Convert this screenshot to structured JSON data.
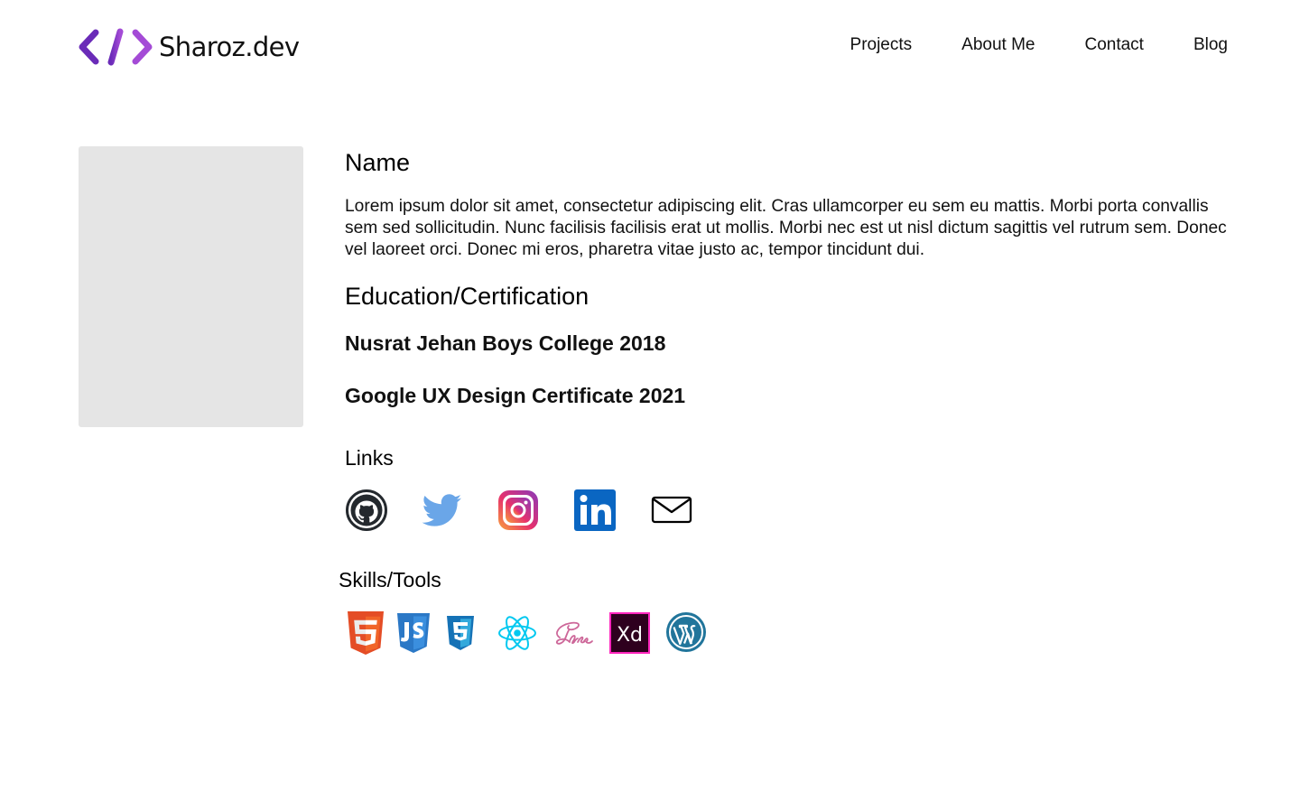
{
  "header": {
    "logo_text": "Sharoz.dev",
    "logo_icon": "code-brackets-icon",
    "brand_color": "#7b2fc9",
    "nav": [
      {
        "label": "Projects"
      },
      {
        "label": "About Me"
      },
      {
        "label": "Contact"
      },
      {
        "label": "Blog"
      }
    ]
  },
  "profile": {
    "photo_placeholder_color": "#e5e5e5",
    "name_heading": "Name",
    "bio": "Lorem ipsum dolor sit amet, consectetur adipiscing elit. Cras ullamcorper eu sem eu mattis. Morbi porta convallis sem sed sollicitudin. Nunc facilisis facilisis erat ut mollis. Morbi nec est ut nisl dictum sagittis vel rutrum sem. Donec vel laoreet orci. Donec mi eros, pharetra vitae justo ac, tempor tincidunt dui.",
    "education_heading": "Education/Certification",
    "education": [
      "Nusrat Jehan Boys College 2018",
      "Google UX Design Certificate 2021"
    ],
    "links_heading": "Links",
    "links": [
      {
        "icon": "github-icon",
        "color": "#24292e"
      },
      {
        "icon": "twitter-icon",
        "color": "#55acee"
      },
      {
        "icon": "instagram-icon",
        "color": "#d6249f"
      },
      {
        "icon": "linkedin-icon",
        "color": "#0077b5"
      },
      {
        "icon": "email-icon",
        "color": "#000000"
      }
    ],
    "skills_heading": "Skills/Tools",
    "skills": [
      {
        "icon": "html5-icon",
        "color": "#e34f26"
      },
      {
        "icon": "javascript-icon",
        "color": "#2a7ac2"
      },
      {
        "icon": "css3-icon",
        "color": "#1572b6"
      },
      {
        "icon": "react-icon",
        "color": "#00d8ff"
      },
      {
        "icon": "sass-icon",
        "color": "#cd6799"
      },
      {
        "icon": "adobe-xd-icon",
        "color": "#ff26be"
      },
      {
        "icon": "wordpress-icon",
        "color": "#21759b"
      }
    ]
  }
}
